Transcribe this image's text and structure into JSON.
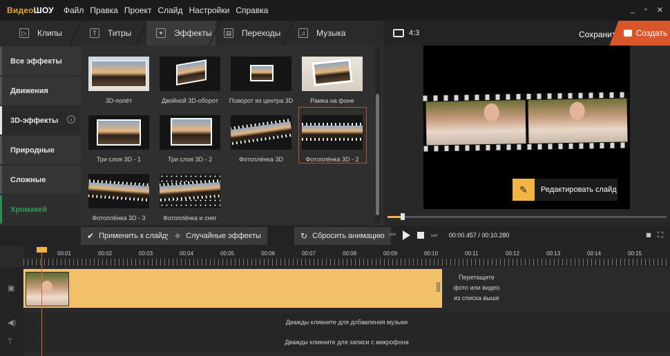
{
  "app": {
    "logo_part1": "Видео",
    "logo_part2": "ШОУ"
  },
  "menu": [
    "Файл",
    "Правка",
    "Проект",
    "Слайд",
    "Настройки",
    "Справка"
  ],
  "window_controls": [
    "_",
    "▫",
    "✕"
  ],
  "tabs": [
    {
      "label": "Клипы",
      "icon": "clips-icon"
    },
    {
      "label": "Титры",
      "icon": "titles-icon"
    },
    {
      "label": "Эффекты",
      "icon": "effects-icon",
      "active": true
    },
    {
      "label": "Переходы",
      "icon": "transitions-icon"
    },
    {
      "label": "Музыка",
      "icon": "music-icon"
    }
  ],
  "preview_header": {
    "aspect": "4:3",
    "save": "Сохранить",
    "create": "Создать"
  },
  "categories": [
    {
      "label": "Все эффекты"
    },
    {
      "label": "Движения"
    },
    {
      "label": "3D-эффекты",
      "active": true
    },
    {
      "label": "Природные"
    },
    {
      "label": "Сложные"
    },
    {
      "label": "Хромакей"
    }
  ],
  "effects": [
    {
      "label": "3D-полёт"
    },
    {
      "label": "Двойной 3D-оборот"
    },
    {
      "label": "Поворот из центра 3D"
    },
    {
      "label": "Рамка на фоне"
    },
    {
      "label": "Три слоя 3D - 1"
    },
    {
      "label": "Три слоя 3D - 2"
    },
    {
      "label": "Фотоплёнка 3D"
    },
    {
      "label": "Фотоплёнка 3D - 2",
      "selected": true
    },
    {
      "label": "Фотоплёнка 3D - 3"
    },
    {
      "label": "Фотоплёнка и снег"
    }
  ],
  "preview": {
    "edit_slide": "Редактировать слайд",
    "seek_fraction": 0.05
  },
  "actions": {
    "apply": "Применить к слайду",
    "random": "Случайные эффекты",
    "reset": "Сбросить анимацию"
  },
  "player": {
    "current": "00:00.457",
    "separator": " / ",
    "total": "00:10.280"
  },
  "timeline": {
    "marks": [
      "00:01",
      "00:02",
      "00:03",
      "00:04",
      "00:05",
      "00:06",
      "00:07",
      "00:08",
      "00:09",
      "00:10",
      "00:11",
      "00:12",
      "00:13",
      "00:14",
      "00:15"
    ],
    "hint_line1": "Перетащите",
    "hint_line2": "фото или видео",
    "hint_line3": "из списка выше",
    "music_lane": "Дважды кликните для добавления музыки",
    "mic_lane": "Дважды кликните для записи с микрофона"
  },
  "colors": {
    "accent": "#f2b445",
    "create": "#d9562a",
    "chroma": "#2f9a58",
    "selection": "#b8552b"
  }
}
